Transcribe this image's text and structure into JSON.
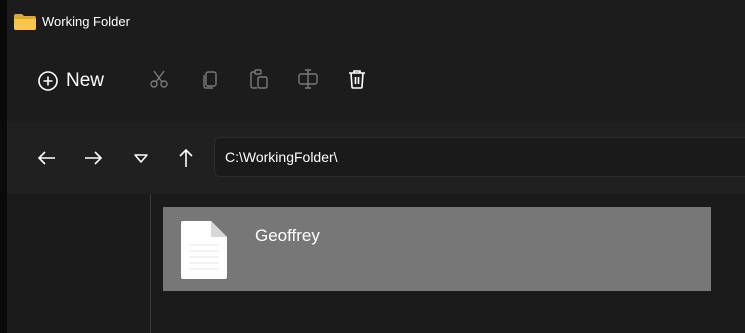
{
  "window": {
    "title": "Working Folder",
    "icon": "folder-icon"
  },
  "toolbar": {
    "new_label": "New",
    "new_icon": "plus-circle-icon",
    "icons": [
      "cut-icon",
      "copy-icon",
      "paste-icon",
      "rename-icon",
      "delete-icon"
    ]
  },
  "navigation": {
    "icons": [
      "back-arrow-icon",
      "forward-arrow-icon",
      "recent-locations-icon",
      "up-arrow-icon"
    ],
    "address": "C:\\WorkingFolder\\"
  },
  "files": [
    {
      "name": "Geoffrey",
      "icon": "document-icon",
      "selected": true
    }
  ],
  "colors": {
    "background": "#1b1b1b",
    "selected_item": "#777777",
    "folder": "#f7c64a"
  }
}
